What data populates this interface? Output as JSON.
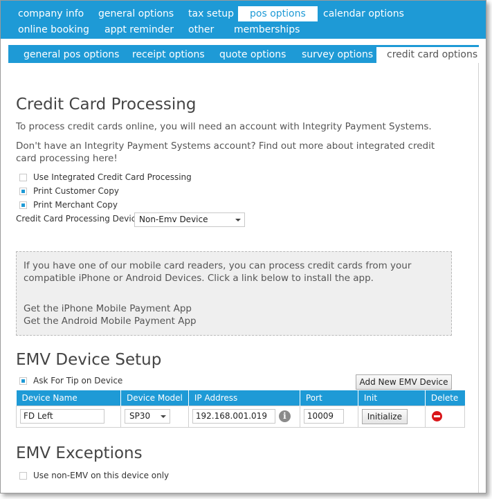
{
  "top_tabs_row1": [
    "company info",
    "general options",
    "tax setup",
    "pos options",
    "calendar options"
  ],
  "top_tabs_row2": [
    "online booking",
    "appt reminder",
    "other",
    "memberships"
  ],
  "sub_tabs": [
    "general pos options",
    "receipt options",
    "quote options",
    "survey options",
    "credit card options"
  ],
  "ccp": {
    "title": "Credit Card Processing",
    "intro": "To process credit cards online, you will need an account with Integrity Payment Systems.",
    "no_account": "Don't have an Integrity Payment Systems account? Find out more about integrated credit card processing here!",
    "checkboxes": [
      {
        "label": "Use Integrated Credit Card Processing",
        "checked": false
      },
      {
        "label": "Print Customer Copy",
        "checked": true
      },
      {
        "label": "Print Merchant Copy",
        "checked": true
      }
    ],
    "device_label": "Credit Card Processing Device",
    "device_value": "Non-Emv Device"
  },
  "mobile": {
    "text": "If you have one of our mobile card readers, you can process credit cards from your compatible iPhone or Android Devices. Click a link below to install the app.",
    "iphone_link": "Get the iPhone Mobile Payment App",
    "android_link": "Get the Android Mobile Payment App"
  },
  "emv": {
    "title": "EMV Device Setup",
    "tip_label": "Ask For Tip on Device",
    "tip_checked": true,
    "add_button": "Add New EMV Device",
    "columns": [
      "Device Name",
      "Device Model",
      "IP Address",
      "Port",
      "Init",
      "Delete"
    ],
    "rows": [
      {
        "name": "FD Left",
        "model": "SP30",
        "ip": "192.168.001.019",
        "port": "10009",
        "init_label": "Initialize"
      }
    ],
    "info_glyph": "i"
  },
  "exceptions": {
    "title": "EMV Exceptions",
    "label": "Use non-EMV on this device only",
    "checked": false
  },
  "icons": {
    "info": "info-icon",
    "delete": "delete-icon",
    "dropdown": "chevron-down-icon"
  },
  "colors": {
    "accent": "#1e9ad6",
    "delete": "#d9161a",
    "panel": "#efefef"
  }
}
